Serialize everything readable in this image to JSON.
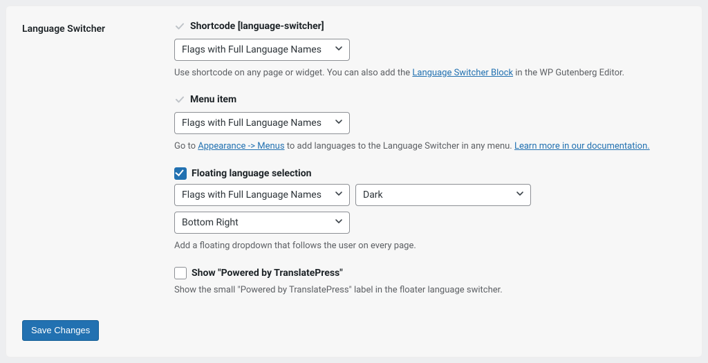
{
  "label": "Language Switcher",
  "sections": {
    "shortcode": {
      "title": "Shortcode [language-switcher]",
      "select": "Flags with Full Language Names",
      "desc_before": "Use shortcode on any page or widget. You can also add the ",
      "link": "Language Switcher Block",
      "desc_after": " in the WP Gutenberg Editor."
    },
    "menu": {
      "title": "Menu item",
      "select": "Flags with Full Language Names",
      "desc_before": "Go to ",
      "link1": "Appearance -> Menus",
      "desc_mid": " to add languages to the Language Switcher in any menu. ",
      "link2": "Learn more in our documentation."
    },
    "floating": {
      "title": "Floating language selection",
      "select_style": "Flags with Full Language Names",
      "select_theme": "Dark",
      "select_position": "Bottom Right",
      "desc": "Add a floating dropdown that follows the user on every page."
    },
    "powered": {
      "title": "Show \"Powered by TranslatePress\"",
      "desc": "Show the small \"Powered by TranslatePress\" label in the floater language switcher."
    }
  },
  "save": "Save Changes"
}
